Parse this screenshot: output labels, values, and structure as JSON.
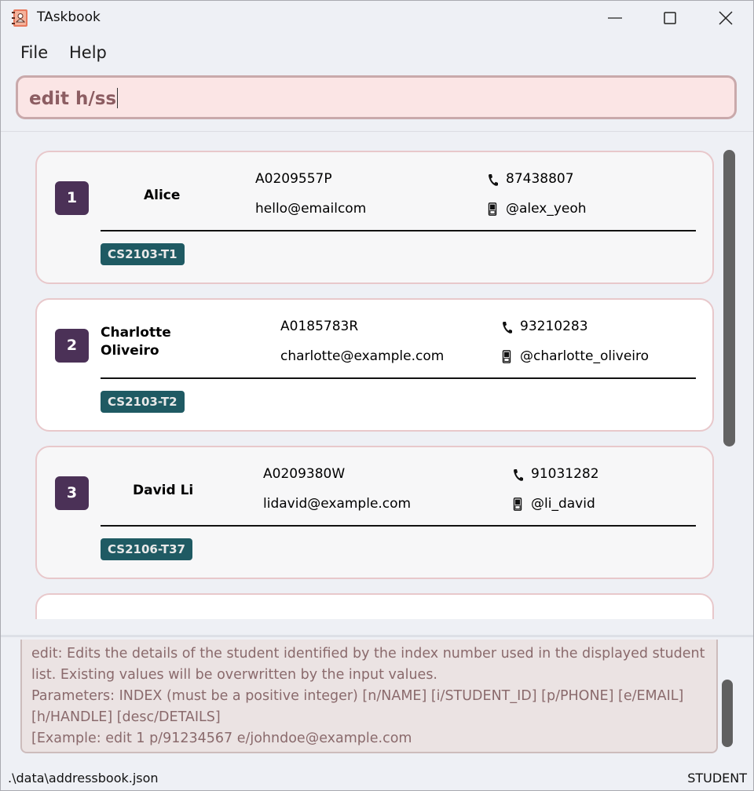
{
  "window": {
    "title": "TAskbook"
  },
  "menu": {
    "file": "File",
    "help": "Help"
  },
  "command": {
    "value": "edit h/ss"
  },
  "students": [
    {
      "index": "1",
      "name": "Alice",
      "student_id": "A0209557P",
      "email": "hello@emailcom",
      "phone": "87438807",
      "handle": "@alex_yeoh",
      "tag": "CS2103-T1"
    },
    {
      "index": "2",
      "name": "Charlotte Oliveiro",
      "student_id": "A0185783R",
      "email": "charlotte@example.com",
      "phone": "93210283",
      "handle": "@charlotte_oliveiro",
      "tag": "CS2103-T2"
    },
    {
      "index": "3",
      "name": "David Li",
      "student_id": "A0209380W",
      "email": "lidavid@example.com",
      "phone": "91031282",
      "handle": "@li_david",
      "tag": "CS2106-T37"
    }
  ],
  "result": {
    "text": "edit: Edits the details of the student identified by the index number used in the displayed student list. Existing values will be overwritten by the input values.\nParameters: INDEX (must be a positive integer) [n/NAME] [i/STUDENT_ID] [p/PHONE] [e/EMAIL] [h/HANDLE] [desc/DETAILS]\n[Example: edit 1 p/91234567 e/johndoe@example.com"
  },
  "status": {
    "path": ".\\data\\addressbook.json",
    "mode": "STUDENT"
  }
}
